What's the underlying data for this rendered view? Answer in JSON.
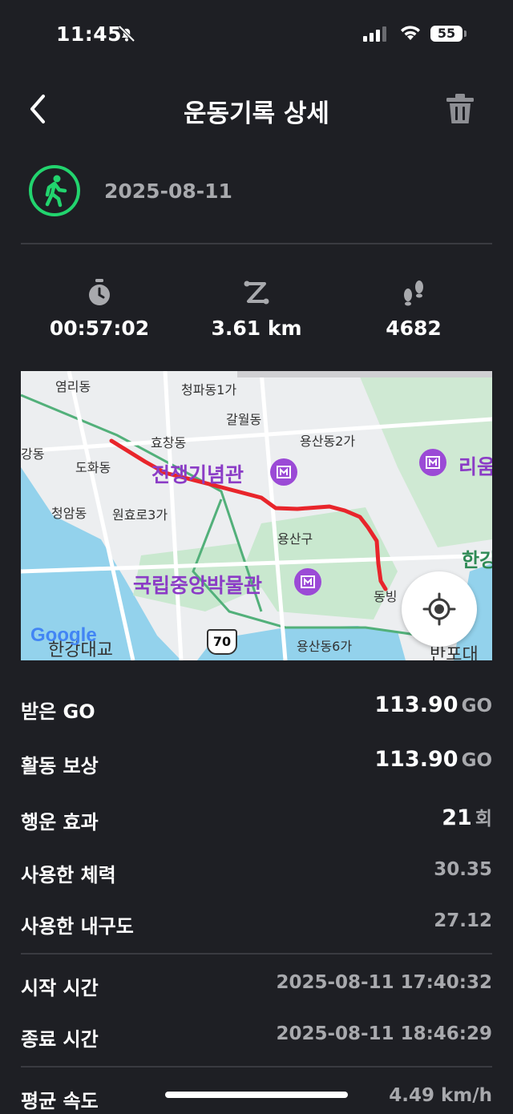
{
  "status_bar": {
    "time": "11:45",
    "battery": "55"
  },
  "header": {
    "title": "운동기록 상세"
  },
  "activity": {
    "date": "2025-08-11"
  },
  "stats": {
    "duration": "00:57:02",
    "distance": "3.61 km",
    "steps": "4682"
  },
  "map": {
    "labels": {
      "yeomni": "염리동",
      "cheongpa": "청파동1가",
      "galwol": "갈월동",
      "hyochang": "효창동",
      "yongsan2": "용산동2가",
      "dohwa": "도화동",
      "gangdong": "강동",
      "cheongam": "청암동",
      "wonhyoro": "원효로3가",
      "yongsangu": "용산구",
      "war_memorial": "전쟁기념관",
      "museum": "국립중앙박물관",
      "leeum": "리움",
      "dongbing": "동빙",
      "han": "한강",
      "yongsan6": "용산동6가",
      "bridge": "한강대교",
      "mapodae": "반포대",
      "route": "70"
    },
    "google": "Google"
  },
  "rows": {
    "go_received": {
      "label": "받은 GO",
      "value": "113.90",
      "unit": "GO"
    },
    "activity_reward": {
      "label": "활동 보상",
      "value": "113.90",
      "unit": "GO"
    },
    "luck_effect": {
      "label": "행운 효과",
      "value": "21",
      "unit": "회"
    },
    "stamina_used": {
      "label": "사용한 체력",
      "value": "30.35"
    },
    "durability_used": {
      "label": "사용한 내구도",
      "value": "27.12"
    },
    "start_time": {
      "label": "시작 시간",
      "value": "2025-08-11 17:40:32"
    },
    "end_time": {
      "label": "종료 시간",
      "value": "2025-08-11 18:46:29"
    },
    "avg_speed": {
      "label": "평균 속도",
      "value": "4.49 km/h"
    }
  },
  "colors": {
    "accent": "#22d46e",
    "route": "#e8252b",
    "poi": "#8b3cc6"
  }
}
